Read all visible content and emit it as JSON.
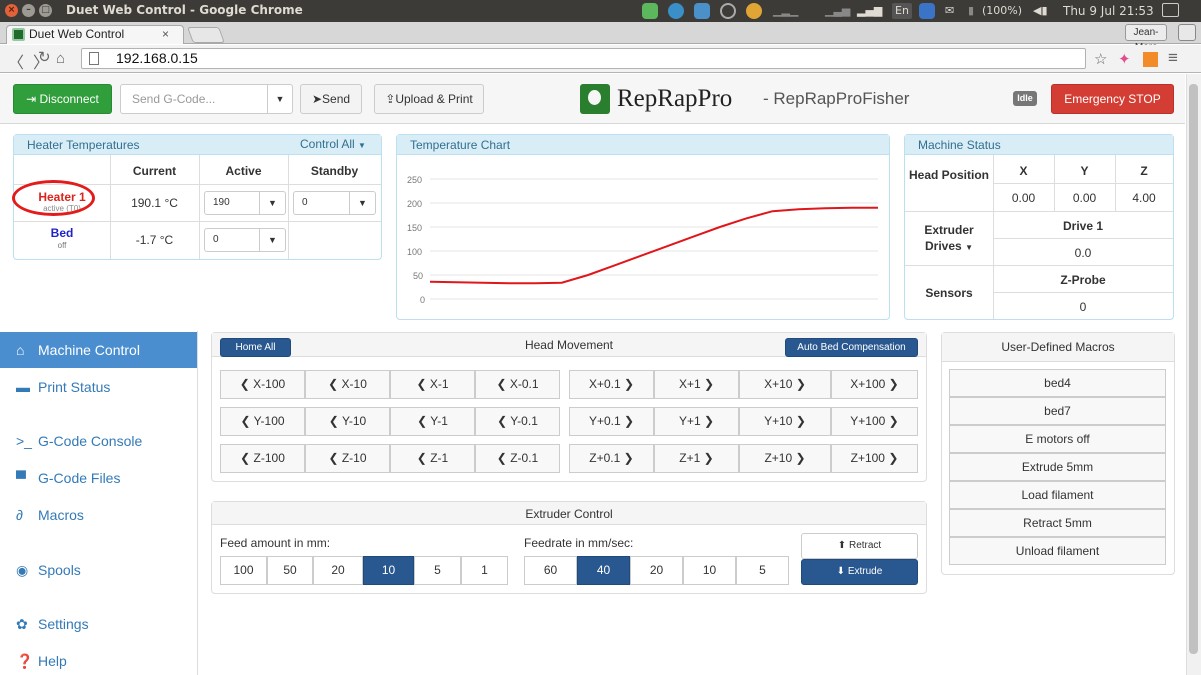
{
  "os": {
    "window_title": "Duet Web Control - Google Chrome",
    "battery": "(100%)",
    "clock": "Thu 9 Jul 21:53",
    "kbd": "En"
  },
  "browser": {
    "tab_title": "Duet Web Control",
    "tab_close": "×",
    "profile": "Jean-Marc",
    "url": "192.168.0.15"
  },
  "header": {
    "disconnect_label": "Disconnect",
    "gcode_placeholder": "Send G-Code...",
    "send_label": "Send",
    "upload_label": "Upload & Print",
    "brand": "RepRapPro",
    "brand_sub": "- RepRapProFisher",
    "status": "Idle",
    "estop_label": "Emergency STOP"
  },
  "heaters": {
    "title": "Heater Temperatures",
    "control_all": "Control All",
    "columns": [
      "Current",
      "Active",
      "Standby"
    ],
    "rows": [
      {
        "name": "Heater 1",
        "state": "active (T0)",
        "current": "190.1 °C",
        "active": "190",
        "standby": "0"
      },
      {
        "name": "Bed",
        "state": "off",
        "current": "-1.7 °C",
        "active": "0"
      }
    ]
  },
  "temp_chart": {
    "title": "Temperature Chart",
    "y_ticks": [
      "250",
      "200",
      "150",
      "100",
      "50",
      "0"
    ]
  },
  "chart_data": {
    "type": "line",
    "title": "Temperature Chart",
    "ylim": [
      0,
      250
    ],
    "series": [
      {
        "values": [
          36,
          35,
          34,
          33,
          33,
          34,
          50,
          70,
          90,
          110,
          130,
          150,
          168,
          183,
          187,
          189,
          190,
          190
        ]
      }
    ]
  },
  "machine": {
    "title": "Machine Status",
    "head_label": "Head Position",
    "axes": [
      "X",
      "Y",
      "Z"
    ],
    "positions": [
      "0.00",
      "0.00",
      "4.00"
    ],
    "extruder_label": "Extruder Drives",
    "drive_label": "Drive 1",
    "drive_value": "0.0",
    "sensors_label": "Sensors",
    "probe_label": "Z-Probe",
    "probe_value": "0"
  },
  "sidebar": {
    "items": [
      {
        "label": "Machine Control",
        "icon": "home-icon"
      },
      {
        "label": "Print Status",
        "icon": "printer-icon"
      },
      {
        "label": "G-Code Console",
        "icon": "console-icon"
      },
      {
        "label": "G-Code Files",
        "icon": "files-icon"
      },
      {
        "label": "Macros",
        "icon": "link-icon"
      },
      {
        "label": "Spools",
        "icon": "spool-icon"
      },
      {
        "label": "Settings",
        "icon": "gear-icon"
      },
      {
        "label": "Help",
        "icon": "help-icon"
      }
    ]
  },
  "head_movement": {
    "title": "Head Movement",
    "home_all": "Home All",
    "auto_bed": "Auto Bed Compensation",
    "rows": [
      [
        "X-100",
        "X-10",
        "X-1",
        "X-0.1",
        "X+0.1",
        "X+1",
        "X+10",
        "X+100"
      ],
      [
        "Y-100",
        "Y-10",
        "Y-1",
        "Y-0.1",
        "Y+0.1",
        "Y+1",
        "Y+10",
        "Y+100"
      ],
      [
        "Z-100",
        "Z-10",
        "Z-1",
        "Z-0.1",
        "Z+0.1",
        "Z+1",
        "Z+10",
        "Z+100"
      ]
    ]
  },
  "extruder": {
    "title": "Extruder Control",
    "feed_label": "Feed amount in mm:",
    "feed_options": [
      "100",
      "50",
      "20",
      "10",
      "5",
      "1"
    ],
    "feed_selected": "10",
    "rate_label": "Feedrate in mm/sec:",
    "rate_options": [
      "60",
      "40",
      "20",
      "10",
      "5"
    ],
    "rate_selected": "40",
    "retract_label": "Retract",
    "extrude_label": "Extrude"
  },
  "macros": {
    "title": "User-Defined Macros",
    "items": [
      "bed4",
      "bed7",
      "E motors off",
      "Extrude 5mm",
      "Load filament",
      "Retract 5mm",
      "Unload filament"
    ]
  },
  "colors": {
    "accent_blue": "#29578f",
    "nav_active": "#4a8ed0",
    "green": "#2f9e3b",
    "red": "#d43d34",
    "heater_red": "#d9251d",
    "bed_blue": "#1f24c8",
    "panel_head": "#d9edf7",
    "chart_line": "#e0161b"
  }
}
